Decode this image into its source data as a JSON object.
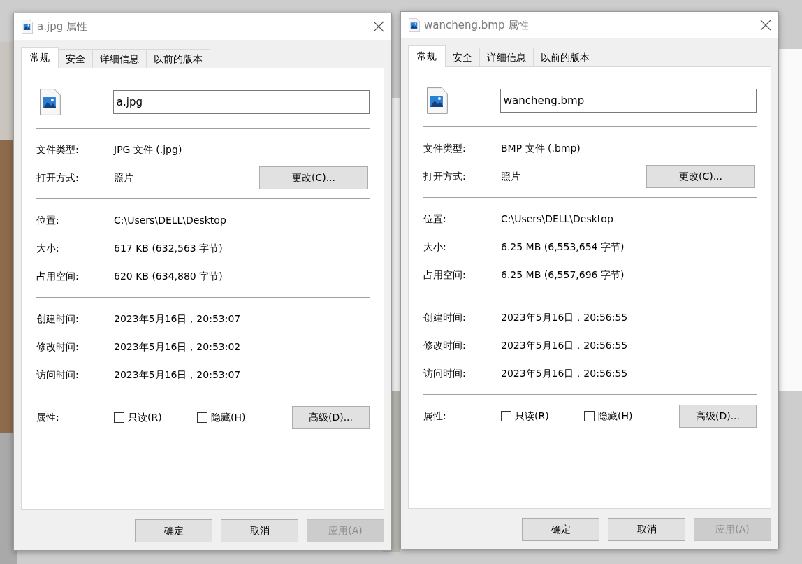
{
  "dialogs": [
    {
      "title": "a.jpg 属性",
      "tabs": [
        {
          "label": "常规",
          "selected": true
        },
        {
          "label": "安全",
          "selected": false
        },
        {
          "label": "详细信息",
          "selected": false
        },
        {
          "label": "以前的版本",
          "selected": false
        }
      ],
      "file_name": "a.jpg",
      "sections": [
        [
          {
            "label": "文件类型:",
            "value": "JPG 文件 (.jpg)"
          },
          {
            "label": "打开方式:",
            "value": "照片",
            "button": "更改(C)..."
          }
        ],
        [
          {
            "label": "位置:",
            "value": "C:\\Users\\DELL\\Desktop"
          },
          {
            "label": "大小:",
            "value": "617 KB (632,563 字节)"
          },
          {
            "label": "占用空间:",
            "value": "620 KB (634,880 字节)"
          }
        ],
        [
          {
            "label": "创建时间:",
            "value": "2023年5月16日，20:53:07"
          },
          {
            "label": "修改时间:",
            "value": "2023年5月16日，20:53:02"
          },
          {
            "label": "访问时间:",
            "value": "2023年5月16日，20:53:07"
          }
        ]
      ],
      "attributes": {
        "label": "属性:",
        "checkboxes": [
          {
            "label": "只读(R)",
            "checked": false
          },
          {
            "label": "隐藏(H)",
            "checked": false
          }
        ],
        "button": "高级(D)..."
      },
      "buttons": [
        {
          "label": "确定",
          "disabled": false
        },
        {
          "label": "取消",
          "disabled": false
        },
        {
          "label": "应用(A)",
          "disabled": true
        }
      ]
    },
    {
      "title": "wancheng.bmp 属性",
      "tabs": [
        {
          "label": "常规",
          "selected": true
        },
        {
          "label": "安全",
          "selected": false
        },
        {
          "label": "详细信息",
          "selected": false
        },
        {
          "label": "以前的版本",
          "selected": false
        }
      ],
      "file_name": "wancheng.bmp",
      "sections": [
        [
          {
            "label": "文件类型:",
            "value": "BMP 文件 (.bmp)"
          },
          {
            "label": "打开方式:",
            "value": "照片",
            "button": "更改(C)..."
          }
        ],
        [
          {
            "label": "位置:",
            "value": "C:\\Users\\DELL\\Desktop"
          },
          {
            "label": "大小:",
            "value": "6.25 MB (6,553,654 字节)"
          },
          {
            "label": "占用空间:",
            "value": "6.25 MB (6,557,696 字节)"
          }
        ],
        [
          {
            "label": "创建时间:",
            "value": "2023年5月16日，20:56:55"
          },
          {
            "label": "修改时间:",
            "value": "2023年5月16日，20:56:55"
          },
          {
            "label": "访问时间:",
            "value": "2023年5月16日，20:56:55"
          }
        ]
      ],
      "attributes": {
        "label": "属性:",
        "checkboxes": [
          {
            "label": "只读(R)",
            "checked": false
          },
          {
            "label": "隐藏(H)",
            "checked": false
          }
        ],
        "button": "高级(D)..."
      },
      "buttons": [
        {
          "label": "确定",
          "disabled": false
        },
        {
          "label": "取消",
          "disabled": false
        },
        {
          "label": "应用(A)",
          "disabled": true
        }
      ]
    }
  ]
}
